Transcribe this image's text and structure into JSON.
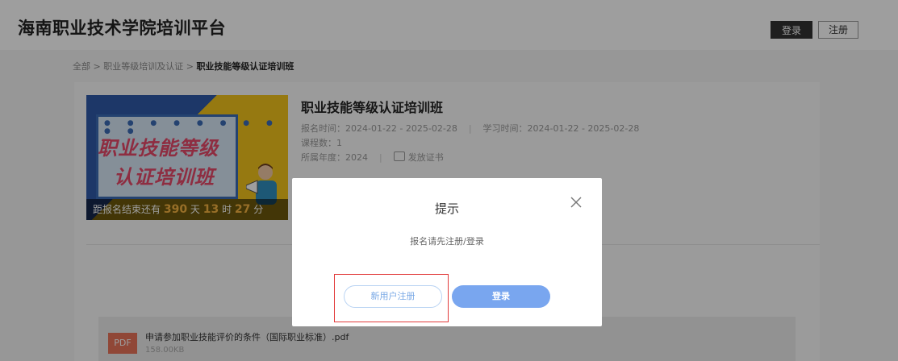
{
  "header": {
    "site_title": "海南职业技术学院培训平台",
    "login_label": "登录",
    "register_label": "注册"
  },
  "breadcrumb": {
    "item1": "全部",
    "sep": ">",
    "item2": "职业等级培训及认证",
    "current": "职业技能等级认证培训班"
  },
  "banner": {
    "dots": "● ● ● ● ● ● ● ● ● ●",
    "line1": "职业技能等级",
    "line2": "认证培训班",
    "countdown_prefix": "距报名结束还有",
    "days": "390",
    "days_unit": "天",
    "hours": "13",
    "hours_unit": "时",
    "minutes": "27",
    "minutes_unit": "分"
  },
  "course": {
    "title": "职业技能等级认证培训班",
    "enroll_time": "报名时间：2024-01-22 - 2025-02-28",
    "study_time": "学习时间：2024-01-22 - 2025-02-28",
    "course_count": "课程数：1",
    "year": "所属年度：2024",
    "cert": "发放证书"
  },
  "file": {
    "badge": "PDF",
    "name": "申请参加职业技能评价的条件（国际职业标准）.pdf",
    "size": "158.00KB"
  },
  "dialog": {
    "title": "提示",
    "message": "报名请先注册/登录",
    "new_user_label": "新用户注册",
    "login_label": "登录"
  },
  "colors": {
    "accent": "#79a6ef",
    "highlight": "#e23b3b",
    "countdown_number": "#f5b342"
  }
}
